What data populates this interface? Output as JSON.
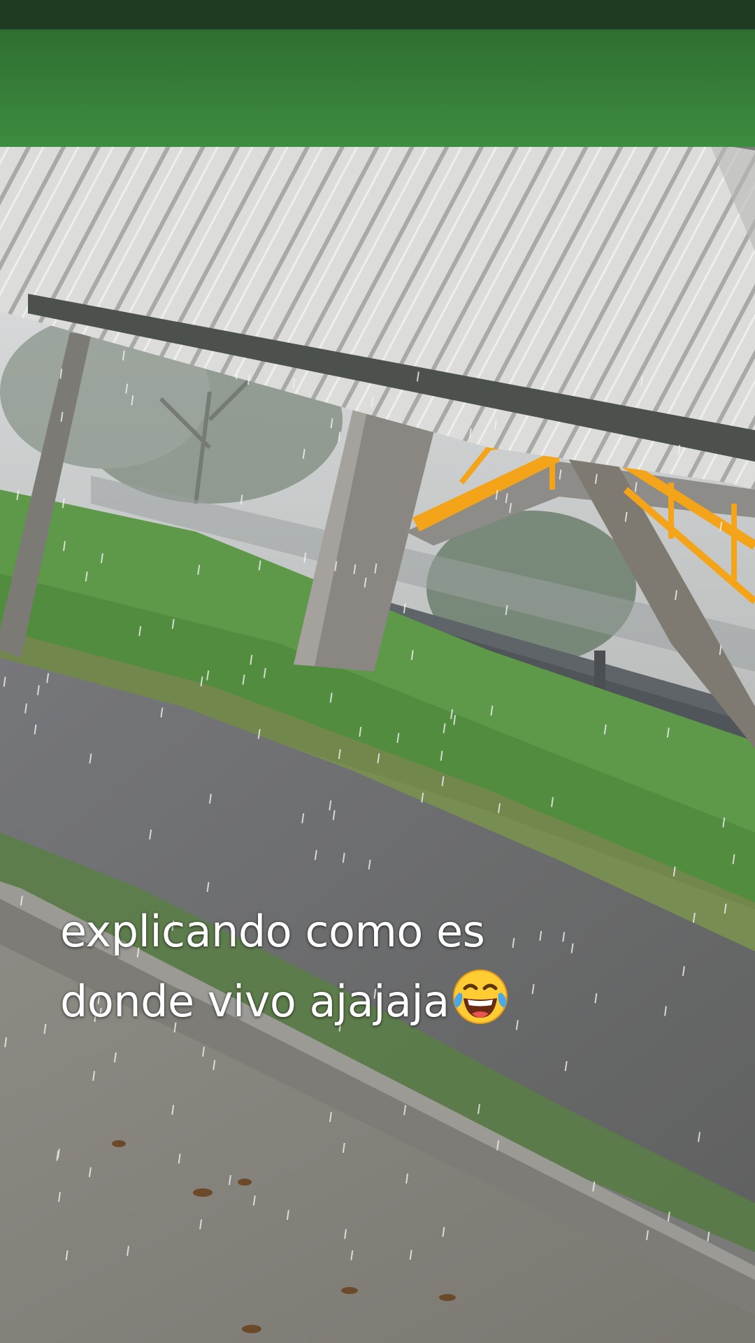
{
  "caption": {
    "line1": "explicando como es",
    "line2": "donde vivo ajajaja",
    "emoji": "face-with-tears-of-joy"
  },
  "colors": {
    "wall_green": "#3f8a3f",
    "roof_white": "#d8d8d6",
    "grass_green": "#5f9a4a",
    "road_gray": "#6f706e",
    "railing_yellow": "#f2a51a",
    "concrete": "#8c8a85"
  }
}
